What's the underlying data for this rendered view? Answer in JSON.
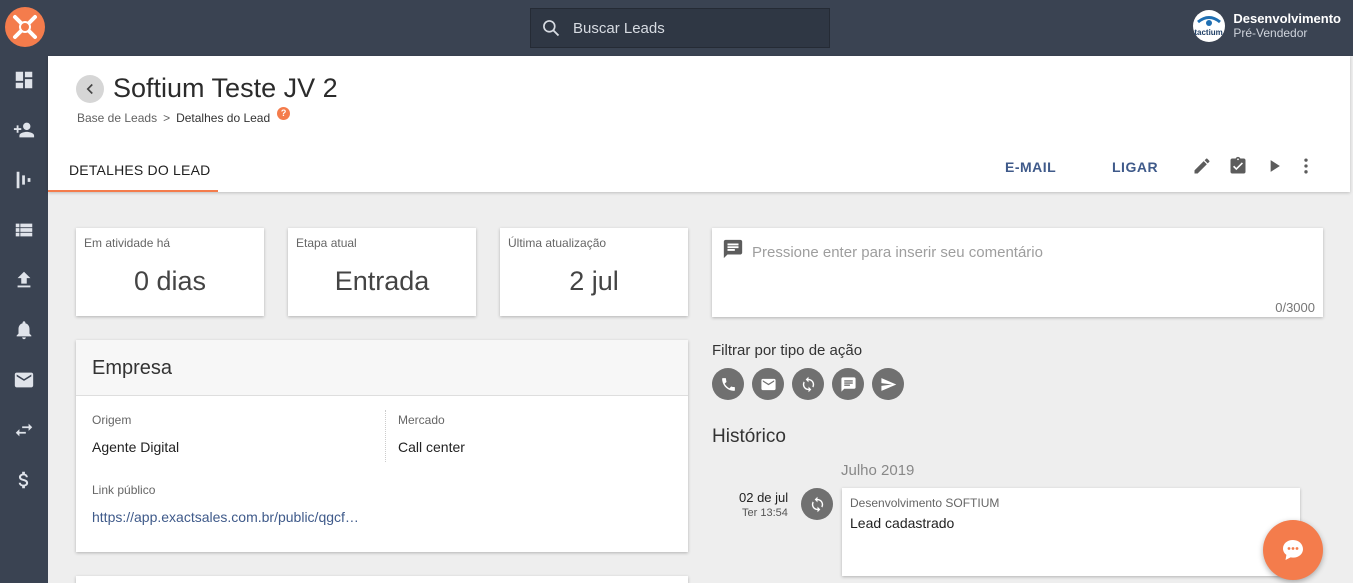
{
  "search": {
    "placeholder": "Buscar Leads"
  },
  "user": {
    "name": "Desenvolvimento",
    "role": "Pré-Vendedor",
    "avatar_text": "tactium"
  },
  "sidebar": {
    "items": [
      {
        "icon": "dashboard-icon"
      },
      {
        "icon": "add-person-icon"
      },
      {
        "icon": "pipeline-icon"
      },
      {
        "icon": "list-icon"
      },
      {
        "icon": "upload-icon"
      },
      {
        "icon": "bell-icon"
      },
      {
        "icon": "mail-icon"
      },
      {
        "icon": "swap-icon"
      },
      {
        "icon": "dollar-icon"
      }
    ]
  },
  "header": {
    "title": "Softium Teste JV 2",
    "breadcrumb": {
      "parent": "Base de Leads",
      "separator": ">",
      "current": "Detalhes do Lead",
      "help": "?"
    },
    "tab": "DETALHES DO LEAD",
    "actions": {
      "email": "E-MAIL",
      "call": "LIGAR"
    }
  },
  "stats": {
    "activity": {
      "label": "Em atividade há",
      "value": "0 dias"
    },
    "stage": {
      "label": "Etapa atual",
      "value": "Entrada"
    },
    "updated": {
      "label": "Última atualização",
      "value": "2 jul"
    }
  },
  "comment": {
    "placeholder": "Pressione enter para inserir seu comentário",
    "counter": "0/3000"
  },
  "company": {
    "title": "Empresa",
    "origin_label": "Origem",
    "origin_value": "Agente Digital",
    "market_label": "Mercado",
    "market_value": "Call center",
    "link_label": "Link público",
    "link_value": "https://app.exactsales.com.br/public/qgcf…"
  },
  "filter": {
    "title": "Filtrar por tipo de ação"
  },
  "history": {
    "title": "Histórico",
    "month": "Julho 2019",
    "entry": {
      "date": "02 de jul",
      "time": "Ter 13:54",
      "author": "Desenvolvimento SOFTIUM",
      "text": "Lead cadastrado"
    }
  },
  "colors": {
    "accent": "#f47c4c",
    "nav": "#3a4352",
    "link": "#3f5a8a"
  }
}
